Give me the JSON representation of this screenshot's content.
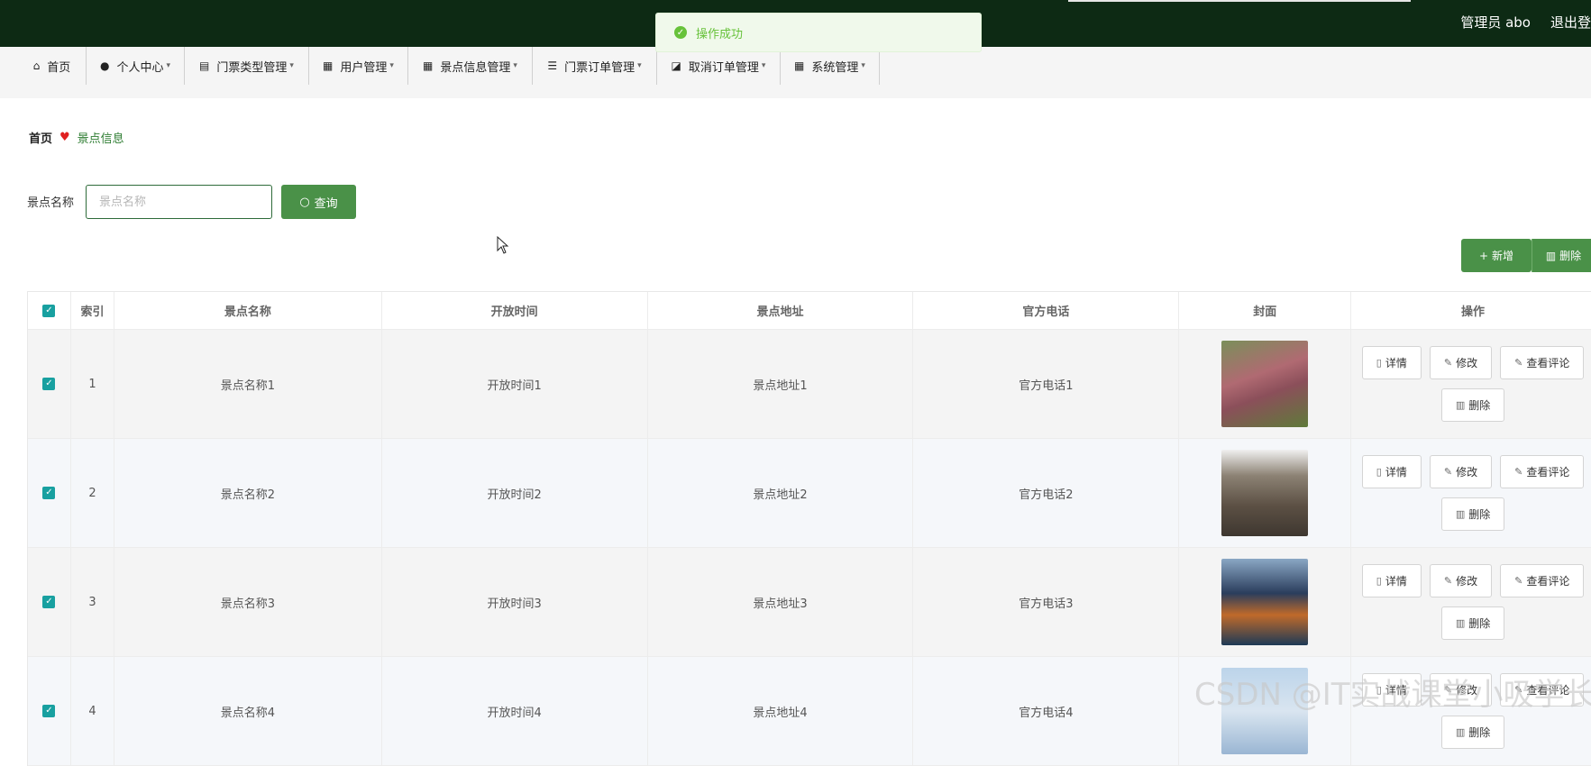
{
  "toast": {
    "message": "操作成功"
  },
  "header": {
    "user": "管理员 abo",
    "logout": "退出登"
  },
  "nav": [
    {
      "label": "首页",
      "icon": "home-icon"
    },
    {
      "label": "个人中心",
      "icon": "user-icon"
    },
    {
      "label": "门票类型管理",
      "icon": "clipboard-icon"
    },
    {
      "label": "用户管理",
      "icon": "grid-icon"
    },
    {
      "label": "景点信息管理",
      "icon": "grid-icon"
    },
    {
      "label": "门票订单管理",
      "icon": "list-icon"
    },
    {
      "label": "取消订单管理",
      "icon": "chart-icon"
    },
    {
      "label": "系统管理",
      "icon": "grid-icon"
    }
  ],
  "breadcrumb": {
    "home": "首页",
    "current": "景点信息"
  },
  "search": {
    "label": "景点名称",
    "placeholder": "景点名称",
    "button": "查询"
  },
  "actions": {
    "add": "新增",
    "delete": "删除"
  },
  "table": {
    "headers": [
      "索引",
      "景点名称",
      "开放时间",
      "景点地址",
      "官方电话",
      "封面",
      "操作"
    ],
    "rows": [
      {
        "index": "1",
        "name": "景点名称1",
        "open_time": "开放时间1",
        "address": "景点地址1",
        "phone": "官方电话1"
      },
      {
        "index": "2",
        "name": "景点名称2",
        "open_time": "开放时间2",
        "address": "景点地址2",
        "phone": "官方电话2"
      },
      {
        "index": "3",
        "name": "景点名称3",
        "open_time": "开放时间3",
        "address": "景点地址3",
        "phone": "官方电话3"
      },
      {
        "index": "4",
        "name": "景点名称4",
        "open_time": "开放时间4",
        "address": "景点地址4",
        "phone": "官方电话4"
      }
    ],
    "row_actions": {
      "detail": "详情",
      "edit": "修改",
      "comments": "查看评论",
      "delete": "删除"
    }
  },
  "watermark": "CSDN @IT实战课堂小吸学长",
  "colors": {
    "topbar": "#0d2a14",
    "primary": "#4a9148",
    "checkbox": "#18a0a0"
  }
}
